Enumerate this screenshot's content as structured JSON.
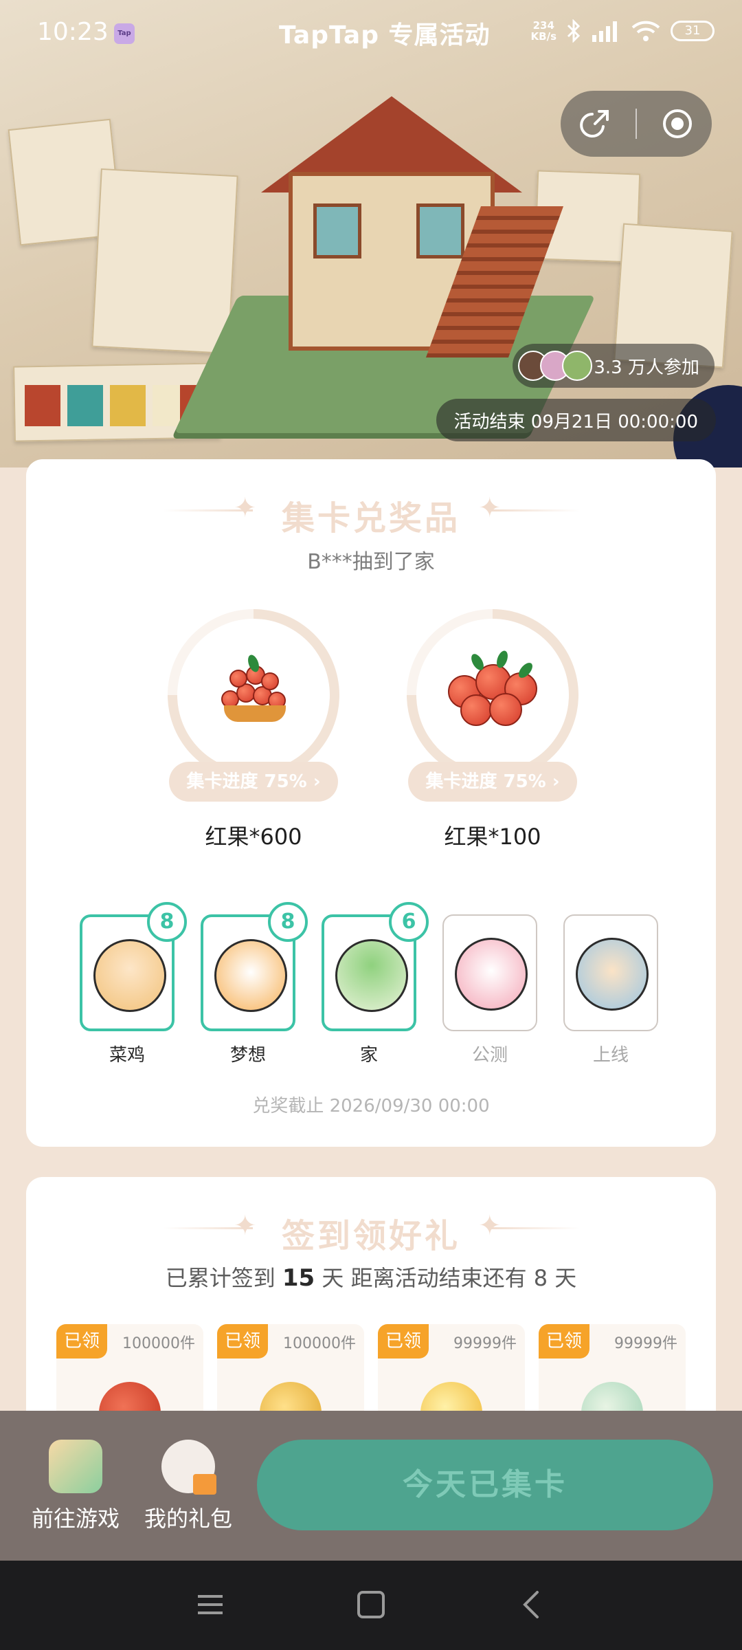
{
  "status_bar": {
    "time": "10:23",
    "app_icon": "taptap-small-icon",
    "title": "TapTap 专属活动",
    "net_speed_value": "234",
    "net_speed_unit": "KB/s",
    "battery": "31"
  },
  "hero": {
    "participants": "3.3 万人参加",
    "deadline": "活动结束 09月21日 00:00:00"
  },
  "collect": {
    "title": "集卡兑奖品",
    "subtitle": "B***抽到了家",
    "prizes": [
      {
        "progress": "集卡进度 75%",
        "progress_value": 0.75,
        "name": "红果*600"
      },
      {
        "progress": "集卡进度 75%",
        "progress_value": 0.75,
        "name": "红果*100"
      }
    ],
    "cards": [
      {
        "label": "菜鸡",
        "count": "8",
        "owned": true
      },
      {
        "label": "梦想",
        "count": "8",
        "owned": true
      },
      {
        "label": "家",
        "count": "6",
        "owned": true
      },
      {
        "label": "公测",
        "count": "",
        "owned": false
      },
      {
        "label": "上线",
        "count": "",
        "owned": false
      }
    ],
    "redeem_deadline": "兑奖截止 2026/09/30 00:00"
  },
  "checkin": {
    "title": "签到领好礼",
    "prefix": "已累计签到",
    "days": "15",
    "suffix": "天  距离活动结束还有 8 天",
    "rewards": [
      {
        "status": "已领",
        "stock": "100000件"
      },
      {
        "status": "已领",
        "stock": "100000件"
      },
      {
        "status": "已领",
        "stock": "99999件"
      },
      {
        "status": "已领",
        "stock": "99999件"
      }
    ]
  },
  "bottom": {
    "go_game": "前往游戏",
    "my_gifts": "我的礼包",
    "cta": "今天已集卡"
  },
  "colors": {
    "accent_teal": "#3cc3a6",
    "claimed_orange": "#f6a329",
    "cta_green": "#4ea48f"
  }
}
